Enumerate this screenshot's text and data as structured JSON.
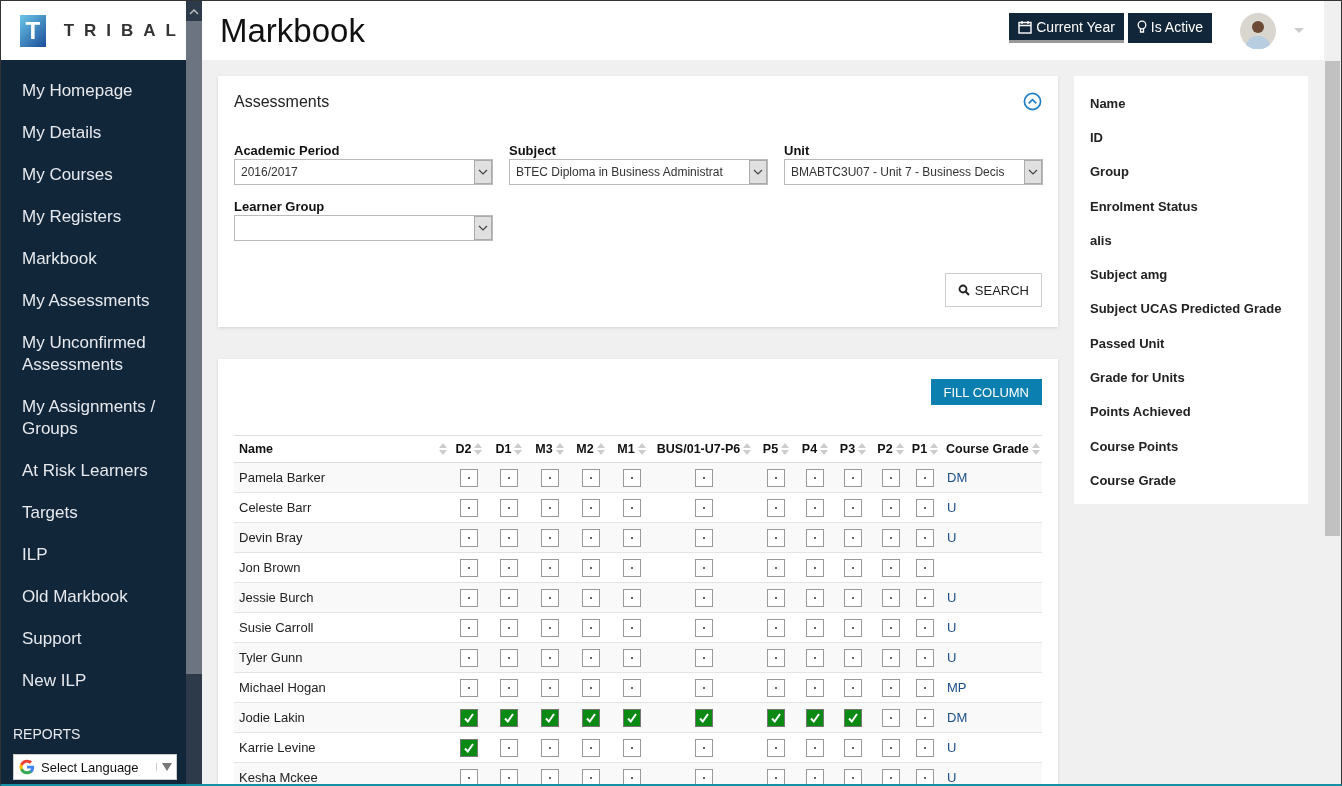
{
  "logo": {
    "letter": "T",
    "text": "TRIBAL"
  },
  "sidebar": {
    "items": [
      "My Homepage",
      "My Details",
      "My Courses",
      "My Registers",
      "Markbook",
      "My Assessments",
      "My Unconfirmed Assessments",
      "My Assignments / Groups",
      "At Risk Learners",
      "Targets",
      "ILP",
      "Old Markbook",
      "Support",
      "New ILP"
    ],
    "section": "REPORTS",
    "language_widget": {
      "label": "Select Language"
    }
  },
  "header": {
    "title": "Markbook",
    "buttons": [
      {
        "label": "Current Year",
        "kind": "calendar",
        "selected": true
      },
      {
        "label": "Is Active",
        "kind": "bulb",
        "selected": false
      }
    ]
  },
  "assessments": {
    "title": "Assessments",
    "fields": [
      {
        "label": "Academic Period",
        "value": "2016/2017"
      },
      {
        "label": "Subject",
        "value": "BTEC Diploma in Business Administrat"
      },
      {
        "label": "Unit",
        "value": "BMABTC3U07 - Unit 7 - Business Decis"
      },
      {
        "label": "Learner Group"
      }
    ],
    "search_button": "SEARCH"
  },
  "grid": {
    "fill_button": "FILL COLUMN",
    "columns": [
      "Name",
      "D2",
      "D1",
      "M3",
      "M2",
      "M1",
      "BUS/01-U7-P6",
      "P5",
      "P4",
      "P3",
      "P2",
      "P1",
      "Course Grade"
    ],
    "rows": [
      {
        "name": "Pamela Barker",
        "marks": [
          false,
          false,
          false,
          false,
          false,
          false,
          false,
          false,
          false,
          false,
          false
        ],
        "grade": "DM"
      },
      {
        "name": "Celeste Barr",
        "marks": [
          false,
          false,
          false,
          false,
          false,
          false,
          false,
          false,
          false,
          false,
          false
        ],
        "grade": "U"
      },
      {
        "name": "Devin Bray",
        "marks": [
          false,
          false,
          false,
          false,
          false,
          false,
          false,
          false,
          false,
          false,
          false
        ],
        "grade": "U"
      },
      {
        "name": "Jon Brown",
        "marks": [
          false,
          false,
          false,
          false,
          false,
          false,
          false,
          false,
          false,
          false,
          false
        ]
      },
      {
        "name": "Jessie Burch",
        "marks": [
          false,
          false,
          false,
          false,
          false,
          false,
          false,
          false,
          false,
          false,
          false
        ],
        "grade": "U"
      },
      {
        "name": "Susie Carroll",
        "marks": [
          false,
          false,
          false,
          false,
          false,
          false,
          false,
          false,
          false,
          false,
          false
        ],
        "grade": "U"
      },
      {
        "name": "Tyler Gunn",
        "marks": [
          false,
          false,
          false,
          false,
          false,
          false,
          false,
          false,
          false,
          false,
          false
        ],
        "grade": "U"
      },
      {
        "name": "Michael Hogan",
        "marks": [
          false,
          false,
          false,
          false,
          false,
          false,
          false,
          false,
          false,
          false,
          false
        ],
        "grade": "MP"
      },
      {
        "name": "Jodie Lakin",
        "marks": [
          true,
          true,
          true,
          true,
          true,
          true,
          true,
          true,
          true,
          false,
          false
        ],
        "grade": "DM"
      },
      {
        "name": "Karrie Levine",
        "marks": [
          true,
          false,
          false,
          false,
          false,
          false,
          false,
          false,
          false,
          false,
          false
        ],
        "grade": "U"
      },
      {
        "name": "Kesha Mckee",
        "marks": [
          false,
          false,
          false,
          false,
          false,
          false,
          false,
          false,
          false,
          false,
          false
        ],
        "grade": "U"
      }
    ]
  },
  "column_panel": {
    "items": [
      "Name",
      "ID",
      "Group",
      "Enrolment Status",
      "alis",
      "Subject amg",
      "Subject UCAS Predicted Grade",
      "Passed Unit",
      "Grade for Units",
      "Points Achieved",
      "Course Points",
      "Course Grade"
    ]
  }
}
